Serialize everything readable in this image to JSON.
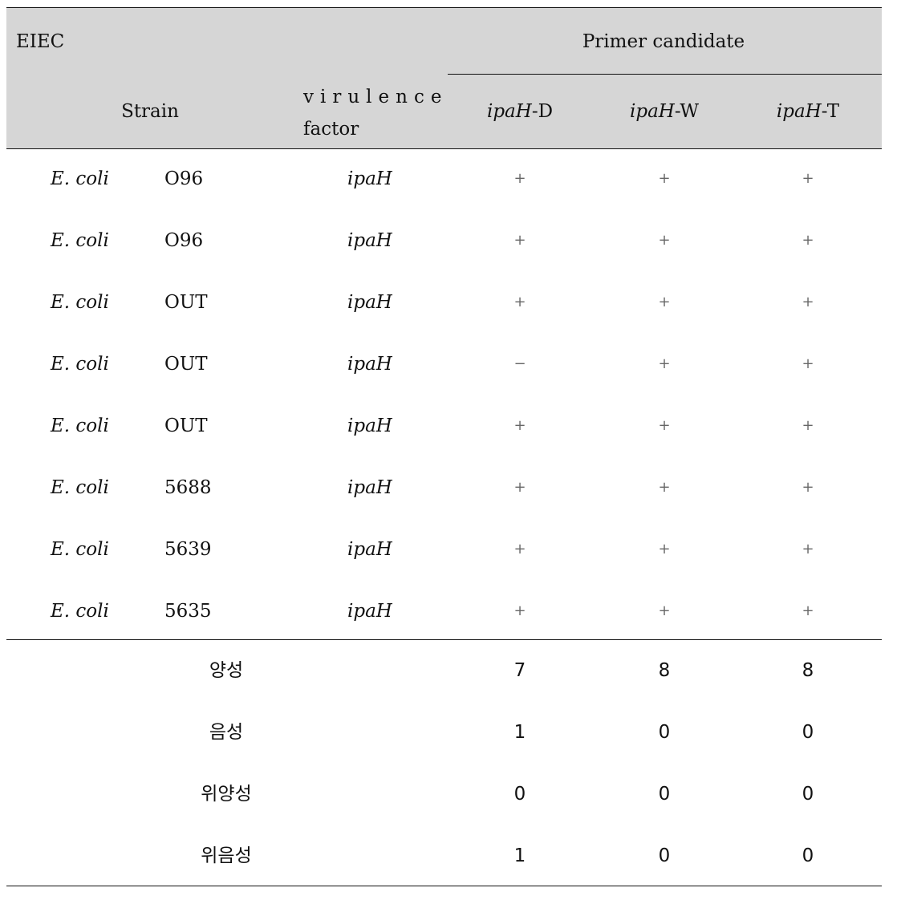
{
  "header": {
    "group_label": "EIEC",
    "primer_group_label": "Primer candidate",
    "strain_label": "Strain",
    "virulence_label_line1": "virulence",
    "virulence_label_line2": "factor",
    "primers": [
      {
        "prefix": "ipaH",
        "suffix": "-D"
      },
      {
        "prefix": "ipaH",
        "suffix": "-W"
      },
      {
        "prefix": "ipaH",
        "suffix": "-T"
      }
    ]
  },
  "rows": [
    {
      "species": "E. coli",
      "strain": "O96",
      "factor": "ipaH",
      "results": [
        "+",
        "+",
        "+"
      ]
    },
    {
      "species": "E. coli",
      "strain": "O96",
      "factor": "ipaH",
      "results": [
        "+",
        "+",
        "+"
      ]
    },
    {
      "species": "E. coli",
      "strain": "OUT",
      "factor": "ipaH",
      "results": [
        "+",
        "+",
        "+"
      ]
    },
    {
      "species": "E. coli",
      "strain": "OUT",
      "factor": "ipaH",
      "results": [
        "−",
        "+",
        "+"
      ]
    },
    {
      "species": "E. coli",
      "strain": "OUT",
      "factor": "ipaH",
      "results": [
        "+",
        "+",
        "+"
      ]
    },
    {
      "species": "E. coli",
      "strain": "5688",
      "factor": "ipaH",
      "results": [
        "+",
        "+",
        "+"
      ]
    },
    {
      "species": "E. coli",
      "strain": "5639",
      "factor": "ipaH",
      "results": [
        "+",
        "+",
        "+"
      ]
    },
    {
      "species": "E. coli",
      "strain": "5635",
      "factor": "ipaH",
      "results": [
        "+",
        "+",
        "+"
      ]
    }
  ],
  "summary": [
    {
      "label": "양성",
      "values": [
        "7",
        "8",
        "8"
      ]
    },
    {
      "label": "음성",
      "values": [
        "1",
        "0",
        "0"
      ]
    },
    {
      "label": "위양성",
      "values": [
        "0",
        "0",
        "0"
      ]
    },
    {
      "label": "위음성",
      "values": [
        "1",
        "0",
        "0"
      ]
    }
  ]
}
